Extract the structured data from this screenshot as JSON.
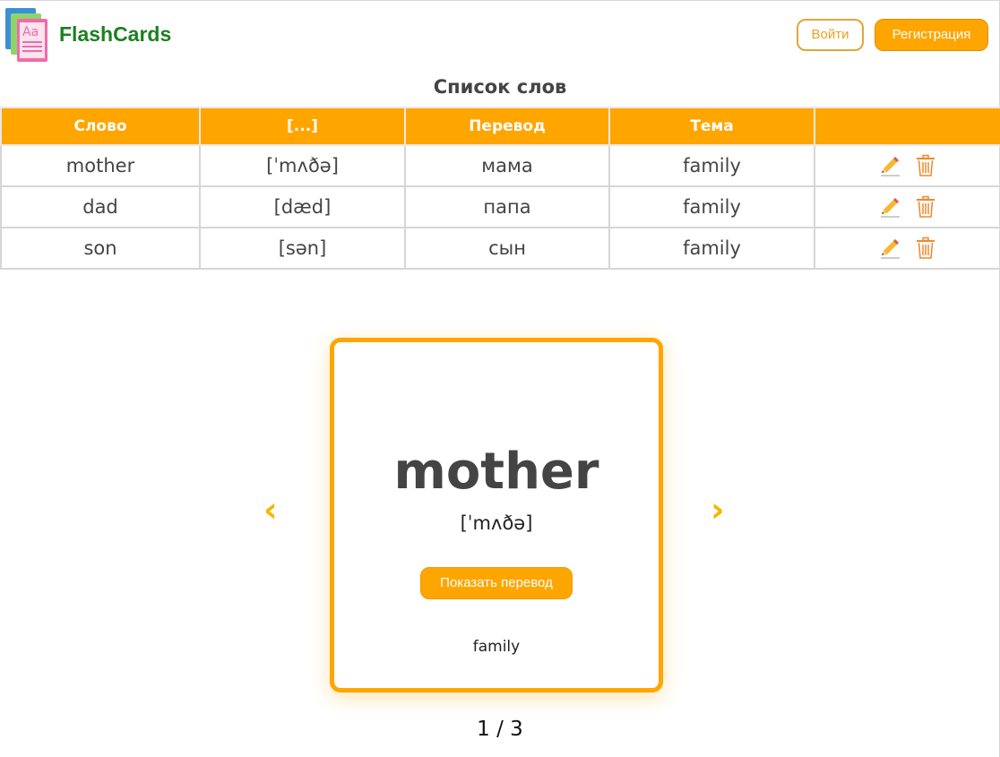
{
  "header": {
    "brand": "FlashCards",
    "login_label": "Войти",
    "register_label": "Регистрация"
  },
  "list": {
    "title": "Список слов",
    "columns": [
      "Слово",
      "[...]",
      "Перевод",
      "Тема",
      ""
    ],
    "rows": [
      {
        "word": "mother",
        "transcription": "[ˈmʌðə]",
        "translation": "мама",
        "topic": "family"
      },
      {
        "word": "dad",
        "transcription": "[dæd]",
        "translation": "папа",
        "topic": "family"
      },
      {
        "word": "son",
        "transcription": "[sən]",
        "translation": "сын",
        "topic": "family"
      }
    ],
    "row_actions": [
      "pencil-icon",
      "trash-icon"
    ]
  },
  "card": {
    "word": "mother",
    "transcription": "[ˈmʌðə]",
    "show_translation_label": "Показать перевод",
    "topic": "family",
    "prev_arrow": "‹",
    "next_arrow": "›",
    "counter": "1 / 3"
  },
  "colors": {
    "accent": "#ffa500",
    "brand_green": "#1d7f20",
    "text": "#444444"
  }
}
